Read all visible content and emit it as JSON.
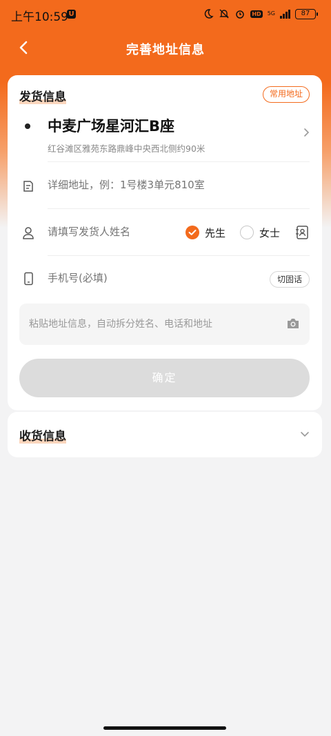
{
  "status_bar": {
    "time": "上午10:59",
    "app_badge": "U",
    "network": "5G",
    "hd": "HD",
    "battery": "87"
  },
  "nav": {
    "title": "完善地址信息"
  },
  "sender": {
    "section_title": "发货信息",
    "common_address_label": "常用地址",
    "address_name": "中麦广场星河汇B座",
    "address_detail": "红谷滩区雅苑东路鼎峰中央西北侧约90米",
    "detail_placeholder": "详细地址，例：1号楼3单元810室",
    "name_placeholder": "请填写发货人姓名",
    "gender_options": [
      "先生",
      "女士"
    ],
    "gender_selected": "先生",
    "phone_placeholder": "手机号(必填)",
    "switch_landline_label": "切固话",
    "paste_placeholder": "粘贴地址信息，自动拆分姓名、电话和地址",
    "confirm_label": "确定"
  },
  "receiver": {
    "section_title": "收货信息"
  },
  "colors": {
    "accent": "#f36a1c",
    "disabled_button": "#dcdcdc",
    "page_bg": "#f3f3f4"
  },
  "icons": [
    "back-arrow-icon",
    "chevron-right-icon",
    "document-icon",
    "person-icon",
    "contacts-book-icon",
    "phone-icon",
    "camera-icon",
    "chevron-down-icon"
  ]
}
